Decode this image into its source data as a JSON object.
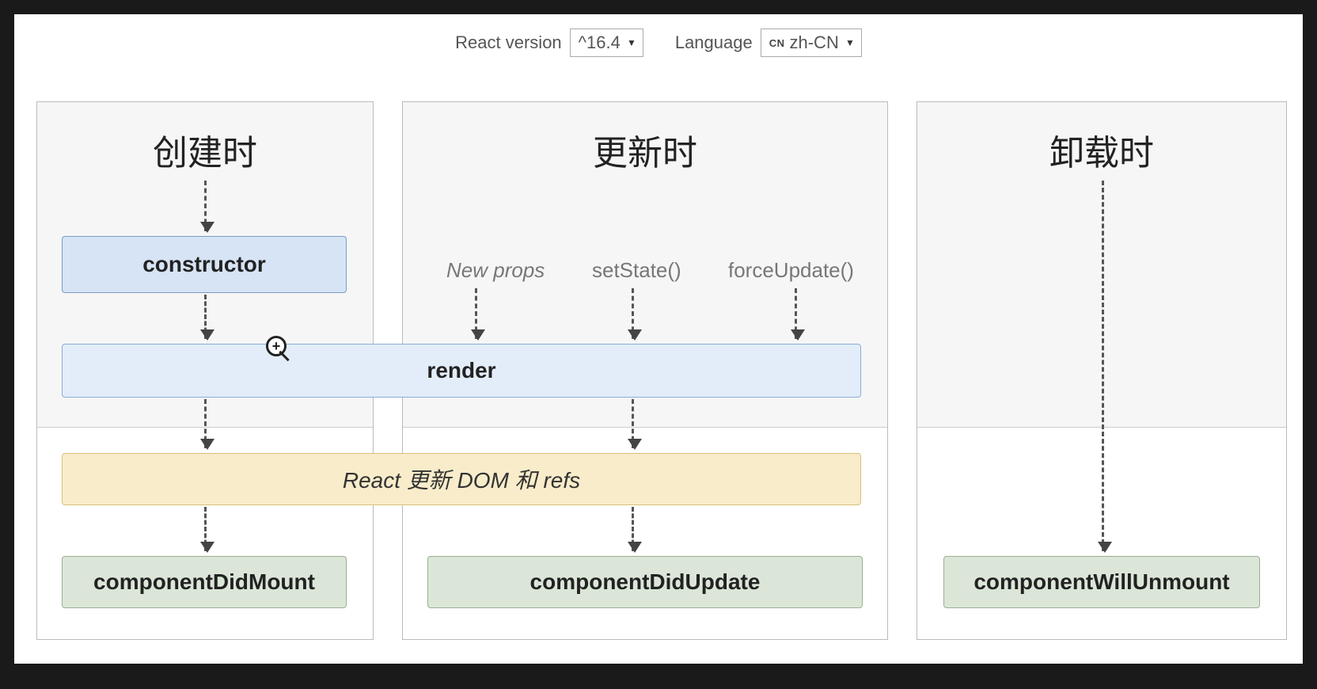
{
  "toolbar": {
    "version_label": "React version",
    "version_value": "^16.4",
    "language_label": "Language",
    "language_badge": "CN",
    "language_value": "zh-CN"
  },
  "columns": {
    "mount_title": "创建时",
    "update_title": "更新时",
    "unmount_title": "卸载时"
  },
  "boxes": {
    "constructor": "constructor",
    "render": "render",
    "dom_update": "React 更新 DOM 和 refs",
    "did_mount": "componentDidMount",
    "did_update": "componentDidUpdate",
    "will_unmount": "componentWillUnmount"
  },
  "triggers": {
    "new_props": "New props",
    "set_state": "setState()",
    "force_update": "forceUpdate()"
  }
}
